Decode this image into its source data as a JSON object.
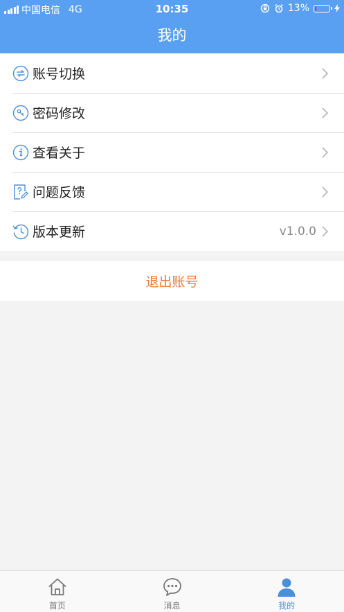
{
  "status_bar": {
    "carrier": "中国电信",
    "network": "4G",
    "time": "10:35",
    "battery": "13%",
    "battery_level": 0.13
  },
  "header": {
    "title": "我的"
  },
  "menu": {
    "items": [
      {
        "label": "账号切换",
        "icon": "switch-icon"
      },
      {
        "label": "密码修改",
        "icon": "key-icon"
      },
      {
        "label": "查看关于",
        "icon": "info-icon"
      },
      {
        "label": "问题反馈",
        "icon": "feedback-icon"
      },
      {
        "label": "版本更新",
        "icon": "history-icon",
        "value": "v1.0.0"
      }
    ]
  },
  "logout": {
    "label": "退出账号"
  },
  "tabbar": {
    "tabs": [
      {
        "label": "首页",
        "icon": "home-icon",
        "active": false
      },
      {
        "label": "消息",
        "icon": "message-icon",
        "active": false
      },
      {
        "label": "我的",
        "icon": "user-icon",
        "active": true
      }
    ]
  },
  "colors": {
    "header": "#5aa0f2",
    "accent": "#4a90d9",
    "logout": "#e87a36",
    "battery_low": "#e23b3b"
  }
}
